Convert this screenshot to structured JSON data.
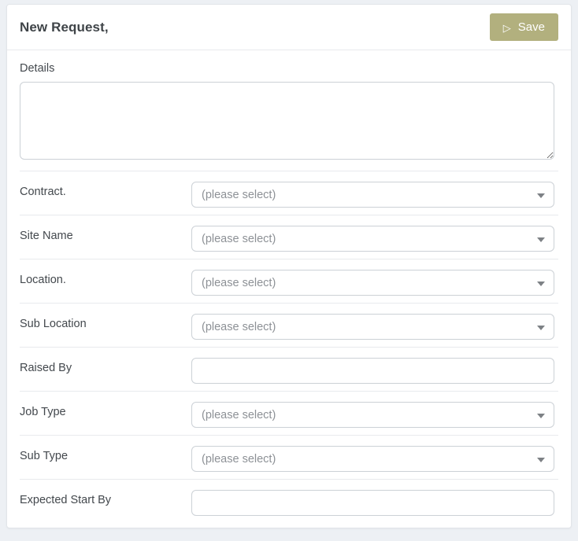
{
  "header": {
    "title": "New Request,",
    "save_button": {
      "label": "Save",
      "icon": "play-icon"
    }
  },
  "details": {
    "label": "Details",
    "value": ""
  },
  "form": {
    "fields": [
      {
        "label": "Contract.",
        "type": "select",
        "value": "(please select)"
      },
      {
        "label": "Site Name",
        "type": "select",
        "value": "(please select)"
      },
      {
        "label": "Location.",
        "type": "select",
        "value": "(please select)"
      },
      {
        "label": "Sub Location",
        "type": "select",
        "value": "(please select)"
      },
      {
        "label": "Raised By",
        "type": "text",
        "value": ""
      },
      {
        "label": "Job Type",
        "type": "select",
        "value": "(please select)"
      },
      {
        "label": "Sub Type",
        "type": "select",
        "value": "(please select)"
      },
      {
        "label": "Expected Start By",
        "type": "text",
        "value": ""
      }
    ]
  },
  "colors": {
    "accent": "#b2b07e",
    "page_background": "#edf0f4",
    "label_text": "#43484d",
    "placeholder_text": "#8d9196",
    "input_border": "#ccd1d6",
    "divider": "#e8eaed"
  }
}
